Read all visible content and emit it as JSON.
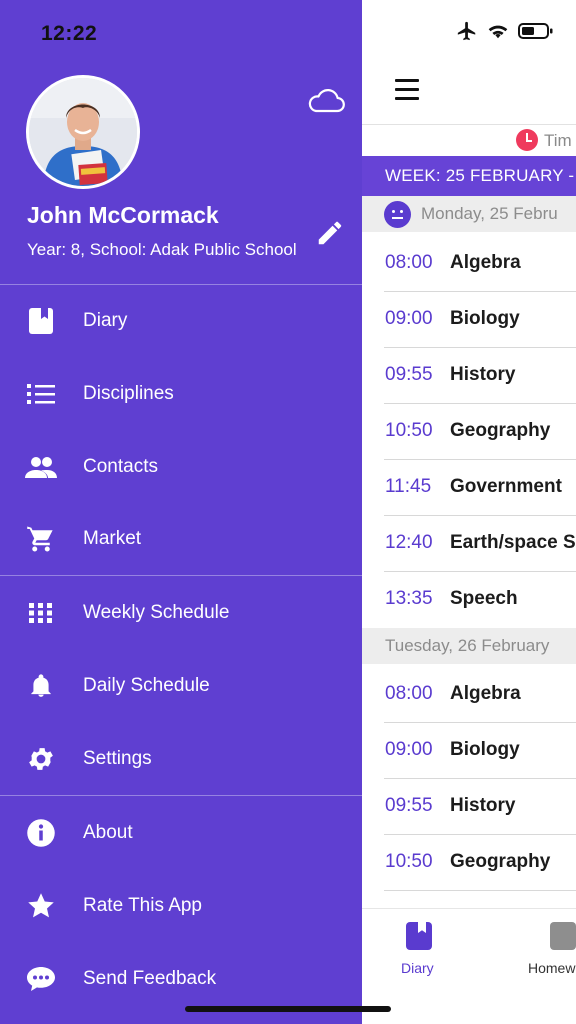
{
  "status_bar": {
    "time": "12:22"
  },
  "profile": {
    "name": "John McCormack",
    "info": "Year: 8, School: Adak Public School"
  },
  "menu": {
    "sections": [
      [
        {
          "label": "Diary",
          "icon": "diary-icon"
        },
        {
          "label": "Disciplines",
          "icon": "list-icon"
        },
        {
          "label": "Contacts",
          "icon": "people-icon"
        },
        {
          "label": "Market",
          "icon": "cart-icon"
        }
      ],
      [
        {
          "label": "Weekly Schedule",
          "icon": "grid-icon"
        },
        {
          "label": "Daily Schedule",
          "icon": "bell-icon"
        },
        {
          "label": "Settings",
          "icon": "gear-icon"
        }
      ],
      [
        {
          "label": "About",
          "icon": "info-icon"
        },
        {
          "label": "Rate This App",
          "icon": "star-icon"
        },
        {
          "label": "Send Feedback",
          "icon": "chat-icon"
        }
      ]
    ]
  },
  "main": {
    "timer_label": "Tim",
    "week_label": "WEEK: 25 FEBRUARY -",
    "days": [
      {
        "label": "Monday, 25 Febru",
        "lessons": [
          {
            "time": "08:00",
            "subject": "Algebra"
          },
          {
            "time": "09:00",
            "subject": "Biology"
          },
          {
            "time": "09:55",
            "subject": "History"
          },
          {
            "time": "10:50",
            "subject": "Geography"
          },
          {
            "time": "11:45",
            "subject": "Government"
          },
          {
            "time": "12:40",
            "subject": "Earth/space S"
          },
          {
            "time": "13:35",
            "subject": "Speech"
          }
        ]
      },
      {
        "label": "Tuesday, 26 February",
        "lessons": [
          {
            "time": "08:00",
            "subject": "Algebra"
          },
          {
            "time": "09:00",
            "subject": "Biology"
          },
          {
            "time": "09:55",
            "subject": "History"
          },
          {
            "time": "10:50",
            "subject": "Geography"
          }
        ]
      }
    ],
    "tabs": [
      {
        "label": "Diary",
        "icon": "diary-icon",
        "active": true
      },
      {
        "label": "Homew",
        "icon": "homework-icon",
        "active": false
      }
    ]
  },
  "colors": {
    "drawer_bg": "#5f3fd1",
    "accent": "#5a3bcf",
    "timer_red": "#ef3a5d"
  }
}
